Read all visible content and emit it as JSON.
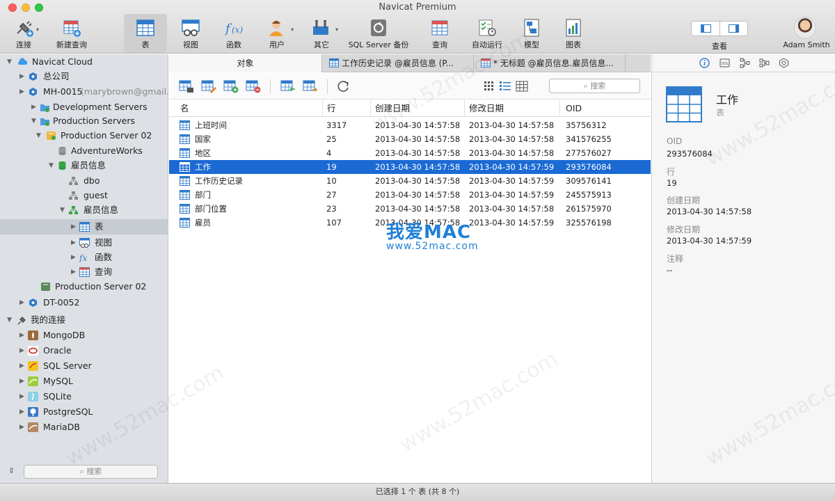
{
  "window": {
    "title": "Navicat Premium"
  },
  "toolbar": {
    "items": [
      {
        "label": "连接",
        "icon": "connection-icon"
      },
      {
        "label": "新建查询",
        "icon": "new-query-icon"
      },
      {
        "label": "表",
        "icon": "table-icon"
      },
      {
        "label": "视图",
        "icon": "view-icon"
      },
      {
        "label": "函数",
        "icon": "function-icon"
      },
      {
        "label": "用户",
        "icon": "user-icon"
      },
      {
        "label": "其它",
        "icon": "tools-icon"
      },
      {
        "label": "SQL Server 备份",
        "icon": "backup-icon"
      },
      {
        "label": "查询",
        "icon": "query-icon"
      },
      {
        "label": "自动运行",
        "icon": "automation-icon"
      },
      {
        "label": "模型",
        "icon": "model-icon"
      },
      {
        "label": "图表",
        "icon": "chart-icon"
      }
    ],
    "view_label": "查看",
    "user_name": "Adam Smith"
  },
  "sidebar": {
    "nodes": [
      {
        "label": "Navicat Cloud",
        "sub": ""
      },
      {
        "label": "总公司",
        "sub": ""
      },
      {
        "label": "MH-0015",
        "sub": "(marybrown@gmail..."
      },
      {
        "label": "Development Servers",
        "sub": ""
      },
      {
        "label": "Production Servers",
        "sub": ""
      },
      {
        "label": "Production Server 02",
        "sub": ""
      },
      {
        "label": "AdventureWorks",
        "sub": ""
      },
      {
        "label": "雇员信息",
        "sub": ""
      },
      {
        "label": "dbo",
        "sub": ""
      },
      {
        "label": "guest",
        "sub": ""
      },
      {
        "label": "雇员信息",
        "sub": ""
      },
      {
        "label": "表",
        "sub": ""
      },
      {
        "label": "视图",
        "sub": ""
      },
      {
        "label": "函数",
        "sub": ""
      },
      {
        "label": "查询",
        "sub": ""
      },
      {
        "label": "Production Server 02",
        "sub": ""
      },
      {
        "label": "DT-0052",
        "sub": ""
      },
      {
        "label": "我的连接",
        "sub": ""
      },
      {
        "label": "MongoDB",
        "sub": ""
      },
      {
        "label": "Oracle",
        "sub": ""
      },
      {
        "label": "SQL Server",
        "sub": ""
      },
      {
        "label": "MySQL",
        "sub": ""
      },
      {
        "label": "SQLite",
        "sub": ""
      },
      {
        "label": "PostgreSQL",
        "sub": ""
      },
      {
        "label": "MariaDB",
        "sub": ""
      }
    ],
    "search_placeholder": "搜索"
  },
  "tabs": [
    {
      "label": "对象"
    },
    {
      "label": "工作历史记录 @雇员信息 (P..."
    },
    {
      "label": "* 无标题 @雇员信息.雇员信息..."
    }
  ],
  "objects": {
    "search_placeholder": "搜索",
    "columns": [
      "名",
      "行",
      "创建日期",
      "修改日期",
      "OID"
    ],
    "rows": [
      {
        "name": "上班时间",
        "rows": "3317",
        "created": "2013-04-30 14:57:58",
        "modified": "2013-04-30 14:57:58",
        "oid": "35756312"
      },
      {
        "name": "国家",
        "rows": "25",
        "created": "2013-04-30 14:57:58",
        "modified": "2013-04-30 14:57:58",
        "oid": "341576255"
      },
      {
        "name": "地区",
        "rows": "4",
        "created": "2013-04-30 14:57:58",
        "modified": "2013-04-30 14:57:58",
        "oid": "277576027"
      },
      {
        "name": "工作",
        "rows": "19",
        "created": "2013-04-30 14:57:58",
        "modified": "2013-04-30 14:57:59",
        "oid": "293576084"
      },
      {
        "name": "工作历史记录",
        "rows": "10",
        "created": "2013-04-30 14:57:58",
        "modified": "2013-04-30 14:57:59",
        "oid": "309576141"
      },
      {
        "name": "部门",
        "rows": "27",
        "created": "2013-04-30 14:57:58",
        "modified": "2013-04-30 14:57:59",
        "oid": "245575913"
      },
      {
        "name": "部门位置",
        "rows": "23",
        "created": "2013-04-30 14:57:58",
        "modified": "2013-04-30 14:57:58",
        "oid": "261575970"
      },
      {
        "name": "雇员",
        "rows": "107",
        "created": "2013-04-30 14:57:58",
        "modified": "2013-04-30 14:57:59",
        "oid": "325576198"
      }
    ]
  },
  "info": {
    "name": "工作",
    "type": "表",
    "fields": [
      {
        "label": "OID",
        "value": "293576084"
      },
      {
        "label": "行",
        "value": "19"
      },
      {
        "label": "创建日期",
        "value": "2013-04-30 14:57:58"
      },
      {
        "label": "修改日期",
        "value": "2013-04-30 14:57:59"
      },
      {
        "label": "注释",
        "value": "--"
      }
    ]
  },
  "status": {
    "text": "已选择 1 个 表 (共 8 个)"
  },
  "watermark": {
    "text": "www.52mac.com",
    "brand": "我爱MAC",
    "brand_url": "www.52mac.com"
  },
  "colors": {
    "accent": "#1b6ad4",
    "sidebar_bg": "#dde0e5"
  }
}
